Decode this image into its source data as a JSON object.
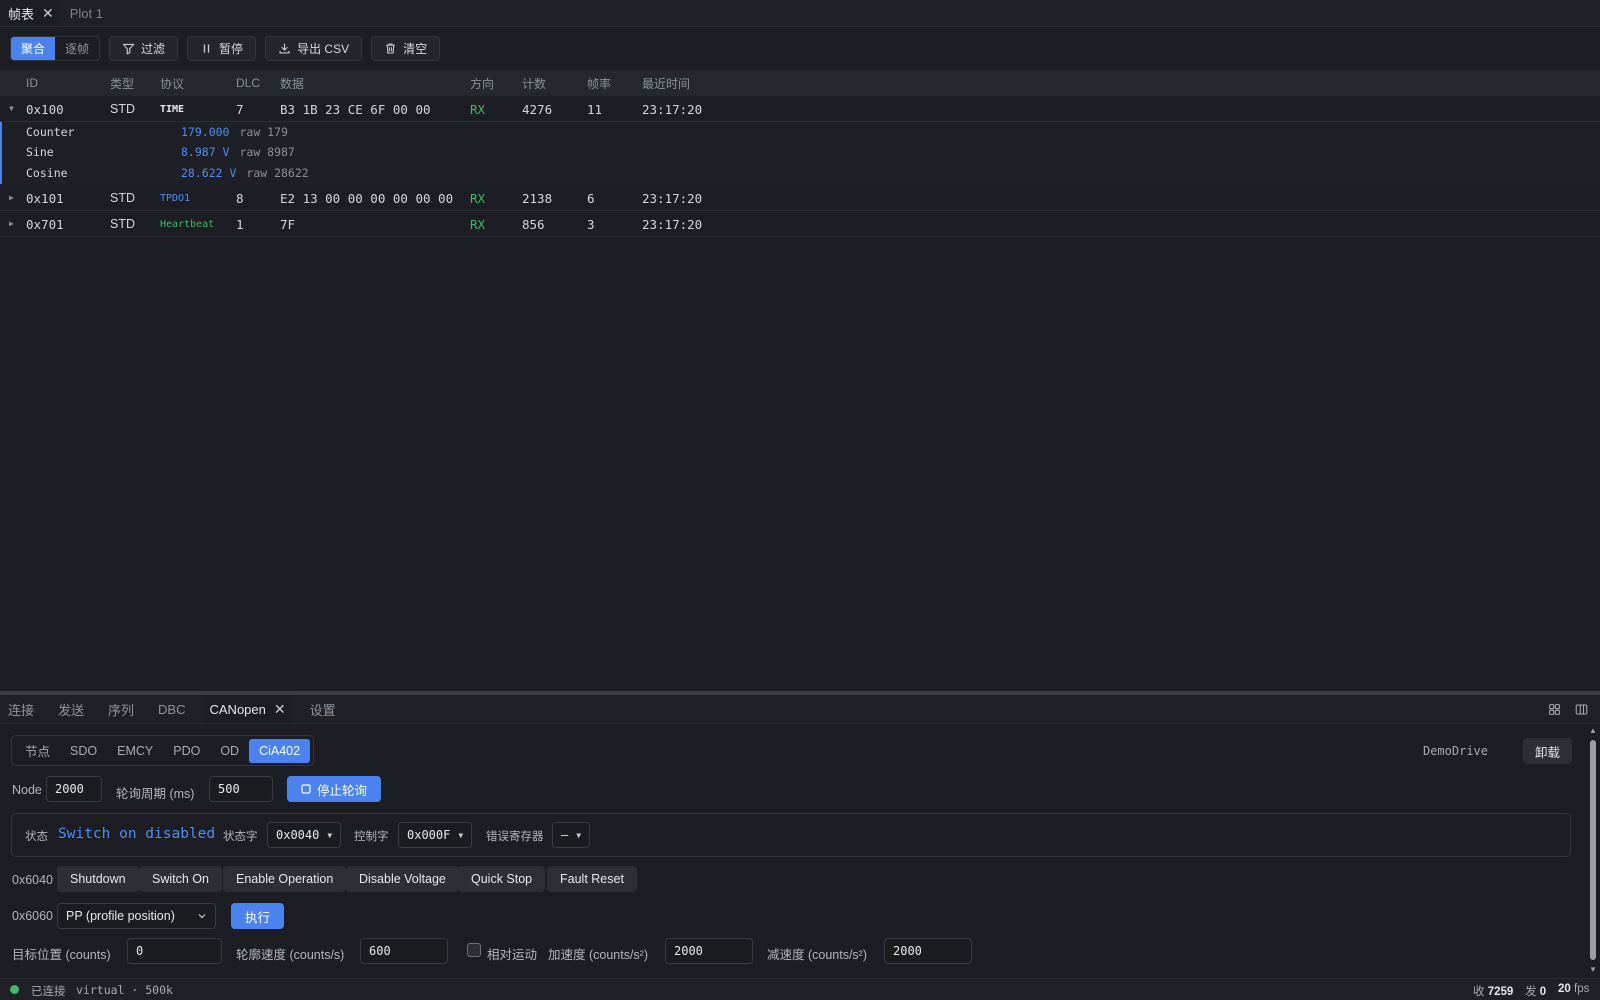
{
  "top_tabs": [
    {
      "label": "帧表",
      "active": true
    },
    {
      "label": "Plot 1",
      "active": false
    }
  ],
  "toolbar": {
    "mode_aggregate": "聚合",
    "mode_per_frame": "逐帧",
    "filter": "过滤",
    "pause": "暂停",
    "export_csv": "导出 CSV",
    "clear": "清空"
  },
  "table": {
    "columns": {
      "id": "ID",
      "type": "类型",
      "protocol": "协议",
      "dlc": "DLC",
      "data": "数据",
      "direction": "方向",
      "count": "计数",
      "rate": "帧率",
      "last_time": "最近时间"
    },
    "rows": [
      {
        "id": "0x100",
        "type": "STD",
        "protocol": "TIME",
        "dlc": "7",
        "data": "B3 1B 23 CE 6F 00 00",
        "direction": "RX",
        "count": "4276",
        "rate": "11",
        "last_time": "23:17:20",
        "expanded": true
      },
      {
        "id": "0x101",
        "type": "STD",
        "protocol": "TPDO1",
        "dlc": "8",
        "data": "E2 13 00 00 00 00 00 00",
        "direction": "RX",
        "count": "2138",
        "rate": "6",
        "last_time": "23:17:20",
        "expanded": false
      },
      {
        "id": "0x701",
        "type": "STD",
        "protocol": "Heartbeat",
        "dlc": "1",
        "data": "7F",
        "direction": "RX",
        "count": "856",
        "rate": "3",
        "last_time": "23:17:20",
        "expanded": false
      }
    ],
    "signals": [
      {
        "name": "Counter",
        "value": "179.000",
        "raw": "raw 179"
      },
      {
        "name": "Sine",
        "value": "8.987 V",
        "raw": "raw 8987"
      },
      {
        "name": "Cosine",
        "value": "28.622 V",
        "raw": "raw 28622"
      }
    ]
  },
  "bottom_tabs": [
    {
      "label": "连接",
      "active": false
    },
    {
      "label": "发送",
      "active": false
    },
    {
      "label": "序列",
      "active": false
    },
    {
      "label": "DBC",
      "active": false
    },
    {
      "label": "CANopen",
      "active": true
    },
    {
      "label": "设置",
      "active": false
    }
  ],
  "canopen": {
    "subtabs": [
      {
        "label": "节点",
        "active": false
      },
      {
        "label": "SDO",
        "active": false
      },
      {
        "label": "EMCY",
        "active": false
      },
      {
        "label": "PDO",
        "active": false
      },
      {
        "label": "OD",
        "active": false
      },
      {
        "label": "CiA402",
        "active": true
      }
    ],
    "drive_name": "DemoDrive",
    "unload": "卸载",
    "node_label": "Node",
    "node_value": "2000",
    "poll_label": "轮询周期 (ms)",
    "poll_value": "500",
    "stop_poll": "停止轮询",
    "state_label": "状态",
    "state_value": "Switch on disabled",
    "statusword_label": "状态字",
    "statusword_value": "0x0040",
    "controlword_label": "控制字",
    "controlword_value": "0x000F",
    "error_reg_label": "错误寄存器",
    "error_reg_value": "—",
    "controlword_index": "0x6040",
    "commands": [
      "Shutdown",
      "Switch On",
      "Enable Operation",
      "Disable Voltage",
      "Quick Stop",
      "Fault Reset"
    ],
    "mode_index": "0x6060",
    "mode_value": "PP (profile position)",
    "execute": "执行",
    "target_pos_label": "目标位置 (counts)",
    "target_pos_value": "0",
    "profile_vel_label": "轮廓速度 (counts/s)",
    "profile_vel_value": "600",
    "relative_label": "相对运动",
    "accel_label": "加速度 (counts/s²)",
    "accel_value": "2000",
    "decel_label": "减速度 (counts/s²)",
    "decel_value": "2000"
  },
  "status_bar": {
    "connected": "已连接",
    "interface": "virtual · 500k",
    "rx_label": "收",
    "rx_value": "7259",
    "tx_label": "发",
    "tx_value": "0",
    "fps_value": "20",
    "fps_unit": "fps"
  },
  "colors": {
    "accent": "#4a83f0",
    "rx": "#3fb86b",
    "signal": "#4f8ef7",
    "background": "#1c1e23"
  },
  "icons": [
    "close-icon",
    "filter-icon",
    "pause-icon",
    "download-icon",
    "trash-icon",
    "caret-down-icon",
    "caret-right-icon",
    "grid-icon",
    "split-icon",
    "stop-icon",
    "chevron-down-icon",
    "connection-dot-icon"
  ]
}
